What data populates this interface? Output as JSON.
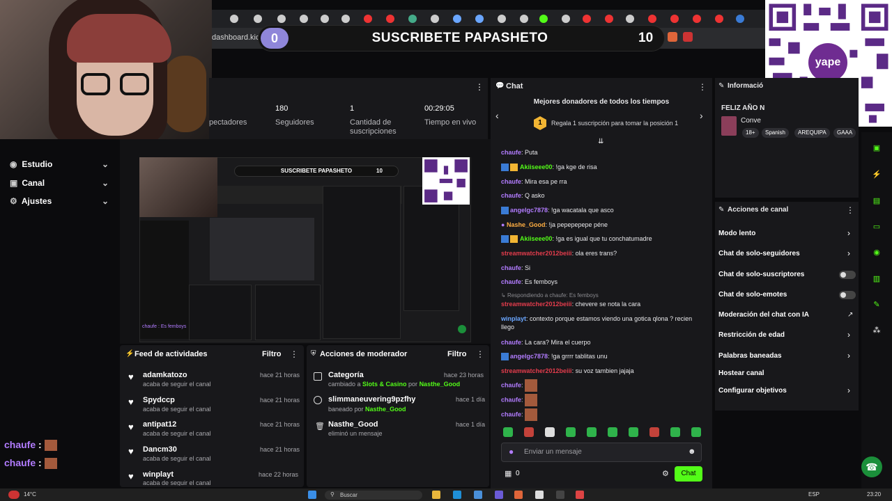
{
  "browser": {
    "address": "dashboard.kick"
  },
  "banner": {
    "badge": "0",
    "title": "SUSCRIBETE PAPASHETO",
    "count": "10"
  },
  "qr": {
    "logo": "yape"
  },
  "stats": [
    {
      "num": "",
      "label": "pectadores"
    },
    {
      "num": "180",
      "label": "Seguidores"
    },
    {
      "num": "1",
      "label": "Cantidad de suscripciones"
    },
    {
      "num": "00:29:05",
      "label": "Tiempo en vivo"
    }
  ],
  "nav": [
    {
      "icon": "compass-icon",
      "label": "Estudio"
    },
    {
      "icon": "user-icon",
      "label": "Canal"
    },
    {
      "icon": "gear-icon",
      "label": "Ajustes"
    }
  ],
  "left_chat": [
    {
      "user": "chaufe",
      "sep": " :"
    },
    {
      "user": "chaufe",
      "sep": " :"
    }
  ],
  "preview": {
    "title": "SUSCRIBETE PAPASHETO",
    "count": "10",
    "chat": "chaufe : Es femboys"
  },
  "feed": {
    "title": "Feed de actividades",
    "filter": "Filtro",
    "items": [
      {
        "name": "adamkatozo",
        "sub": "acaba de seguir el canal",
        "time": "hace 21 horas"
      },
      {
        "name": "Spydccp",
        "sub": "acaba de seguir el canal",
        "time": "hace 21 horas"
      },
      {
        "name": "antipat12",
        "sub": "acaba de seguir el canal",
        "time": "hace 21 horas"
      },
      {
        "name": "Dancm30",
        "sub": "acaba de seguir el canal",
        "time": "hace 21 horas"
      },
      {
        "name": "winplayt",
        "sub": "acaba de seguir el canal",
        "time": "hace 22 horas"
      }
    ]
  },
  "modactions": {
    "title": "Acciones de moderador",
    "filter": "Filtro",
    "items": [
      {
        "name": "Categoría",
        "pre": "cambiado a ",
        "hl": "Slots & Casino",
        "mid": " por ",
        "by": "Nasthe_Good",
        "time": "hace 23 horas"
      },
      {
        "name": "slimmaneuvering9pzfhy",
        "pre": "baneado por ",
        "hl": "",
        "mid": "",
        "by": "Nasthe_Good",
        "time": "hace 1 día"
      },
      {
        "name": "Nasthe_Good",
        "pre": "eliminó un mensaje",
        "hl": "",
        "mid": "",
        "by": "",
        "time": "hace 1 día"
      }
    ]
  },
  "chat": {
    "title": "Chat",
    "donors_title": "Mejores donadores de todos los tiempos",
    "donor_rank": "1",
    "donor_text": "Regala 1 suscripción para tomar la posición 1",
    "messages": [
      {
        "user": "chaufe",
        "text": ": Puta"
      },
      {
        "user": "Akiiseee00",
        "text": ": !ga kge de risa"
      },
      {
        "user": "chaufe",
        "text": ": Mira esa pe rra"
      },
      {
        "user": "chaufe",
        "text": ": Q asko"
      },
      {
        "user": "angelgc7878",
        "text": ": !ga wacatala que asco"
      },
      {
        "user": "Nashe_Good",
        "text": ": !ja pepepepepe péne"
      },
      {
        "user": "Akiiseee00",
        "text": ": !ga es igual que tu conchatumadre"
      },
      {
        "user": "streamwatcher2012beiii",
        "text": ": ola eres trans?"
      },
      {
        "user": "chaufe",
        "text": ": Si"
      },
      {
        "user": "chaufe",
        "text": ": Es femboys"
      },
      {
        "reply": "Respondiendo a chaufe: Es femboys",
        "user": "streamwatcher2012beiii",
        "text": ": chevere se nota la cara"
      },
      {
        "user": "winplayt",
        "text": ": contexto porque estamos viendo una gotica qlona ? recien llego"
      },
      {
        "user": "chaufe",
        "text": ": La cara? Mira el cuerpo"
      },
      {
        "user": "angelgc7878",
        "text": ": !ga grrrr tablitas unu"
      },
      {
        "user": "streamwatcher2012beiii",
        "text": ": su voz tambien jajaja"
      },
      {
        "user": "chaufe",
        "text": ":"
      },
      {
        "user": "chaufe",
        "text": ":"
      },
      {
        "user": "chaufe",
        "text": ":"
      }
    ],
    "input_placeholder": "Enviar un mensaje",
    "send": "Chat",
    "count": "0"
  },
  "info": {
    "title": "Informació",
    "stream_title": "FELIZ AÑO N",
    "category": "Conve",
    "tags": [
      "18+",
      "Spanish",
      "AREQUIPA",
      "GAAA"
    ]
  },
  "canal": {
    "title": "Acciones de canal",
    "items": [
      {
        "label": "Modo lento",
        "ctrl": "chev"
      },
      {
        "label": "Chat de solo-seguidores",
        "ctrl": "chev"
      },
      {
        "label": "Chat de solo-suscriptores",
        "ctrl": "toggle"
      },
      {
        "label": "Chat de solo-emotes",
        "ctrl": "toggle"
      },
      {
        "label": "Moderación del chat con IA",
        "ctrl": "link"
      },
      {
        "label": "Restricción de edad",
        "ctrl": "chev"
      },
      {
        "label": "Palabras baneadas",
        "ctrl": "chev"
      },
      {
        "label": "Hostear canal",
        "ctrl": "none"
      },
      {
        "label": "Configurar objetivos",
        "ctrl": "chev"
      }
    ]
  },
  "taskbar": {
    "temp": "14°C",
    "search": "Buscar",
    "lang": "ESP",
    "clock": "23:20"
  },
  "colors": {
    "accent": "#53fc18",
    "user": "#b27cff",
    "panel": "#18181b"
  }
}
